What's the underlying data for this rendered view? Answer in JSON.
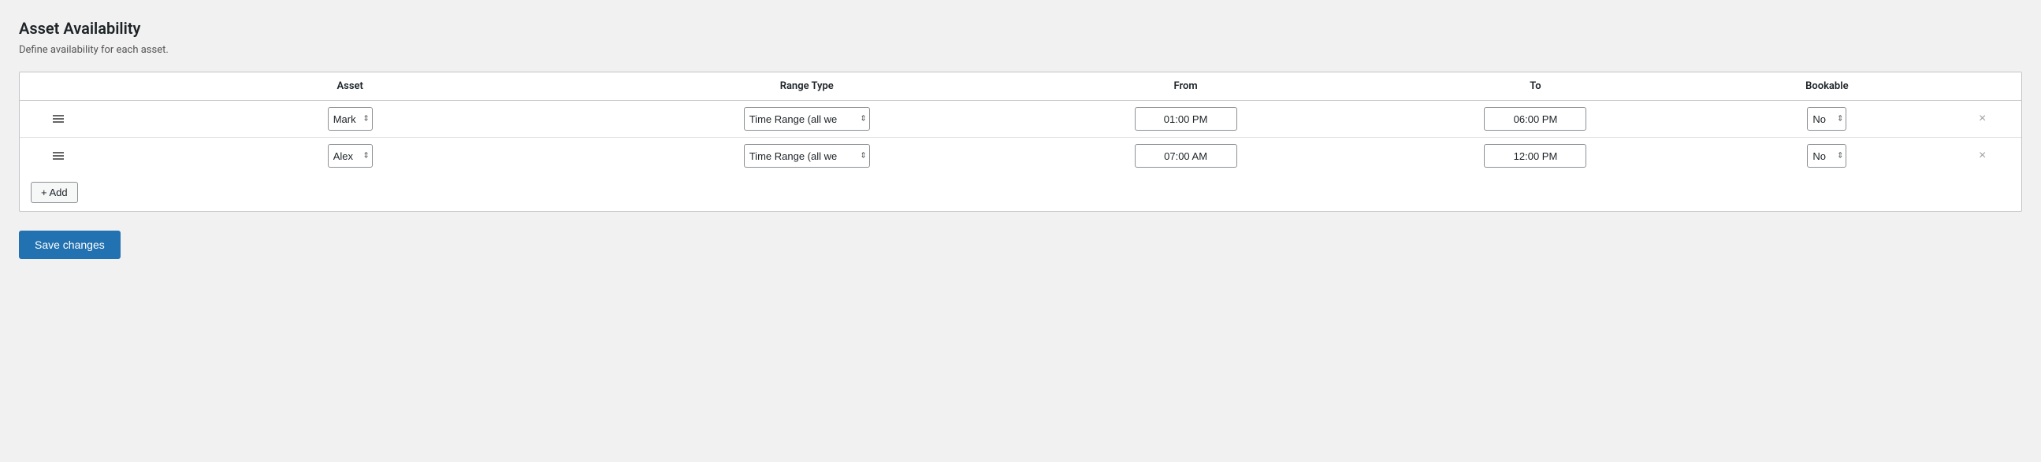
{
  "page": {
    "title": "Asset Availability",
    "subtitle": "Define availability for each asset."
  },
  "table": {
    "columns": [
      {
        "key": "drag",
        "label": ""
      },
      {
        "key": "asset",
        "label": "Asset"
      },
      {
        "key": "range_type",
        "label": "Range Type"
      },
      {
        "key": "from",
        "label": "From"
      },
      {
        "key": "to",
        "label": "To"
      },
      {
        "key": "bookable",
        "label": "Bookable"
      },
      {
        "key": "remove",
        "label": ""
      }
    ],
    "rows": [
      {
        "asset": "Mark",
        "range_type": "Time Range (all we",
        "from": "01:00 PM",
        "to": "06:00 PM",
        "bookable": "No"
      },
      {
        "asset": "Alex",
        "range_type": "Time Range (all we",
        "from": "07:00 AM",
        "to": "12:00 PM",
        "bookable": "No"
      }
    ],
    "add_button_label": "+ Add"
  },
  "footer": {
    "save_button_label": "Save changes"
  },
  "icons": {
    "drag": "≡",
    "remove": "×"
  }
}
